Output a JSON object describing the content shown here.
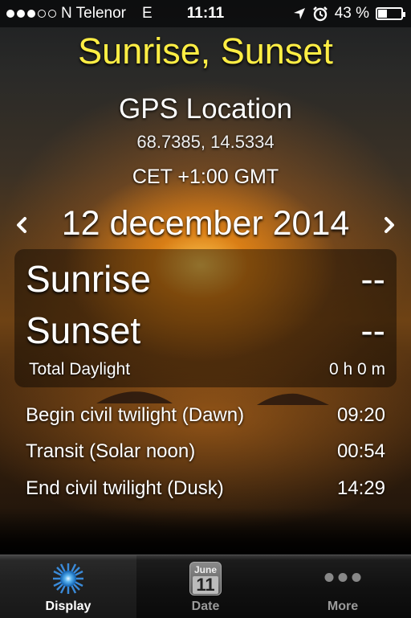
{
  "status_bar": {
    "carrier": "N Telenor",
    "network": "E",
    "time": "11:11",
    "battery_text": "43 %",
    "battery_level": 0.43
  },
  "app": {
    "title": "Sunrise, Sunset"
  },
  "location": {
    "title": "GPS Location",
    "coords": "68.7385, 14.5334",
    "timezone": "CET +1:00 GMT"
  },
  "date_nav": {
    "date": "12 december 2014"
  },
  "summary": {
    "sunrise_label": "Sunrise",
    "sunrise_value": "--",
    "sunset_label": "Sunset",
    "sunset_value": "--",
    "daylight_label": "Total Daylight",
    "daylight_value": "0 h 0 m"
  },
  "details": [
    {
      "label": "Begin civil twilight (Dawn)",
      "value": "09:20"
    },
    {
      "label": "Transit (Solar noon)",
      "value": "00:54"
    },
    {
      "label": "End civil twilight (Dusk)",
      "value": "14:29"
    }
  ],
  "tabbar": {
    "tabs": [
      {
        "label": "Display",
        "icon": "sun-burst-icon",
        "active": true
      },
      {
        "label": "Date",
        "icon": "calendar-icon",
        "cal_month": "June",
        "cal_day": "11"
      },
      {
        "label": "More",
        "icon": "more-dots-icon"
      }
    ]
  },
  "colors": {
    "title": "#ffee44",
    "background_glow": "#f0a020"
  }
}
